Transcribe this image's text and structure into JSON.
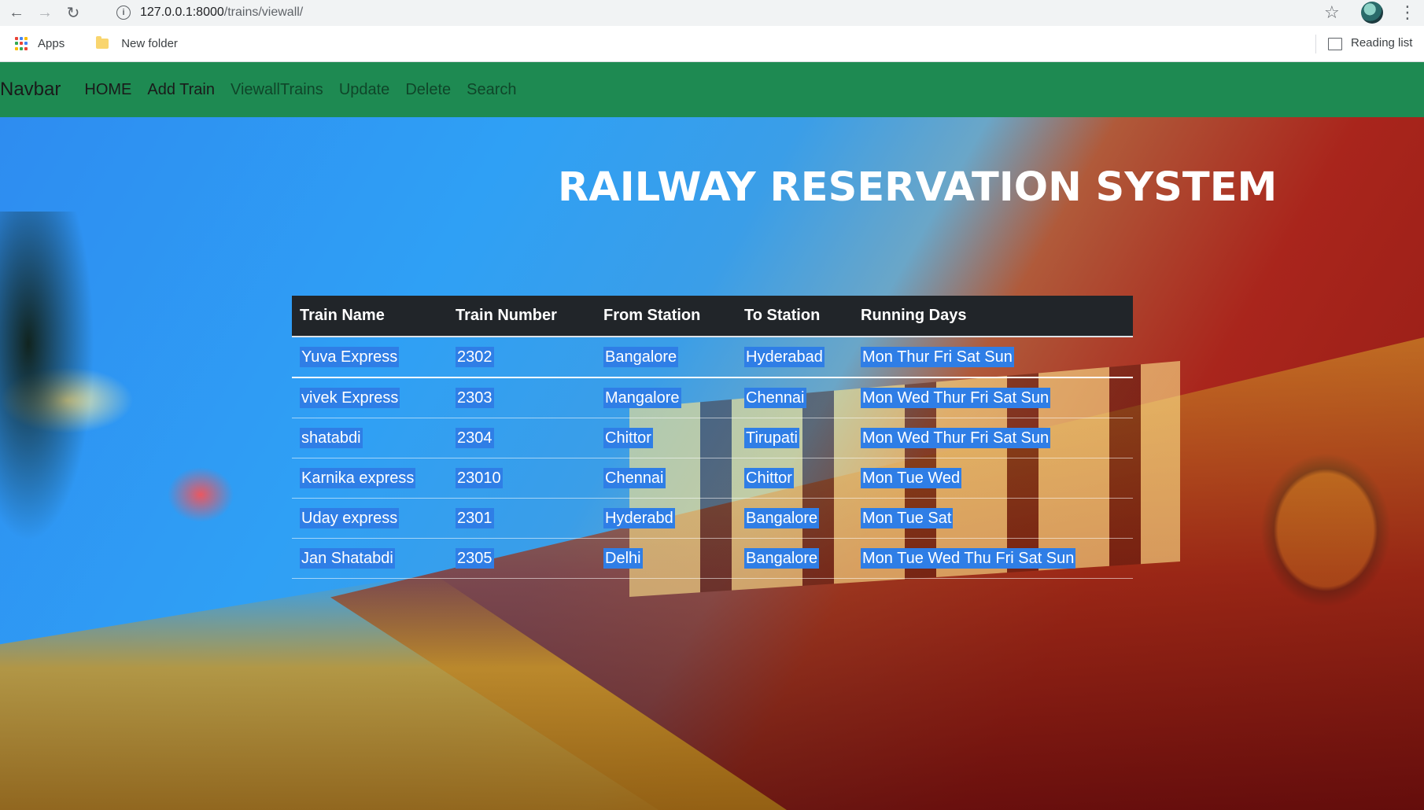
{
  "browser": {
    "url_host": "127.0.0.1:8000",
    "url_path": "/trains/viewall/",
    "bookmarks": [
      {
        "label": "Apps"
      },
      {
        "label": "New folder"
      }
    ],
    "reading_list_label": "Reading list"
  },
  "navbar": {
    "brand": "Navbar",
    "links": [
      {
        "label": "HOME"
      },
      {
        "label": "Add Train"
      },
      {
        "label": "ViewallTrains"
      },
      {
        "label": "Update"
      },
      {
        "label": "Delete"
      },
      {
        "label": "Search"
      }
    ],
    "color": "#1e8a52"
  },
  "main": {
    "heading": "RAILWAY RESERVATION SYSTEM",
    "table": {
      "headers": [
        "Train Name",
        "Train Number",
        "From Station",
        "To Station",
        "Running Days"
      ],
      "rows": [
        [
          "Yuva Express",
          "2302",
          "Bangalore",
          "Hyderabad",
          "Mon Thur Fri Sat Sun"
        ],
        [
          "vivek Express",
          "2303",
          "Mangalore",
          "Chennai",
          "Mon Wed Thur Fri Sat Sun"
        ],
        [
          "shatabdi",
          "2304",
          "Chittor",
          "Tirupati",
          "Mon Wed Thur Fri Sat Sun"
        ],
        [
          "Karnika express",
          "23010",
          "Chennai",
          "Chittor",
          "Mon Tue Wed"
        ],
        [
          "Uday express",
          "2301",
          "Hyderabd",
          "Bangalore",
          "Mon Tue Sat"
        ],
        [
          "Jan Shatabdi",
          "2305",
          "Delhi",
          "Bangalore",
          "Mon Tue Wed Thu Fri Sat Sun"
        ]
      ]
    },
    "header_color": "#212529",
    "selection_color": "#2f7ee6"
  }
}
